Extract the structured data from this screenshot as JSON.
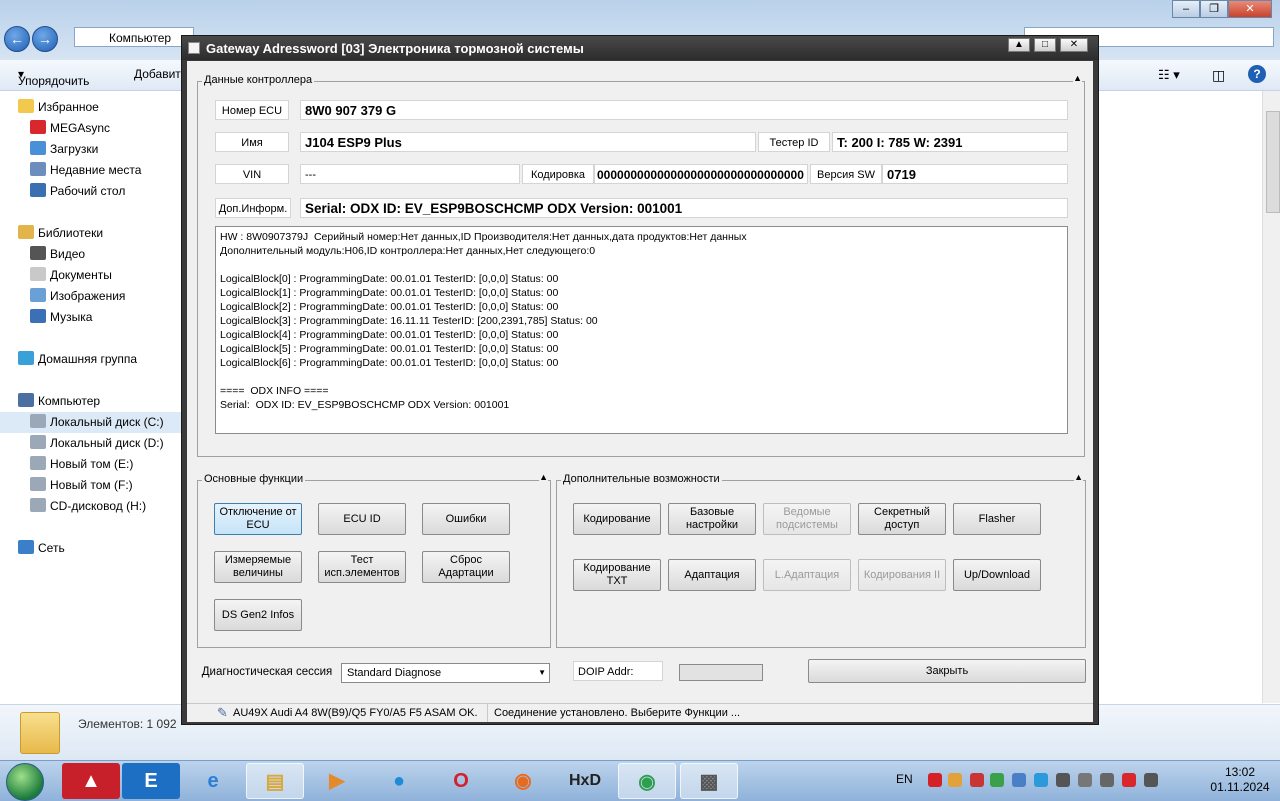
{
  "explorer": {
    "address": "Компьютер",
    "toolbar": {
      "organize": "Упорядочить",
      "add": "Добавит"
    },
    "sidebar": [
      {
        "label": "Избранное",
        "color": "#f2c94c"
      },
      {
        "label": "MEGAsync",
        "color": "#d9272e"
      },
      {
        "label": "Загрузки",
        "color": "#4a90d9"
      },
      {
        "label": "Недавние места",
        "color": "#6c8ebf"
      },
      {
        "label": "Рабочий стол",
        "color": "#3a6fb0"
      },
      {
        "label": "Библиотеки",
        "color": "#e2b44b"
      },
      {
        "label": "Видео",
        "color": "#555555"
      },
      {
        "label": "Документы",
        "color": "#c9c9c9"
      },
      {
        "label": "Изображения",
        "color": "#6aa0d8"
      },
      {
        "label": "Музыка",
        "color": "#3b6fb6"
      },
      {
        "label": "Домашняя группа",
        "color": "#3aa0d8"
      },
      {
        "label": "Компьютер",
        "color": "#4a6fa0"
      },
      {
        "label": "Локальный диск (C:)",
        "color": "#9aa8b8"
      },
      {
        "label": "Локальный диск (D:)",
        "color": "#9aa8b8"
      },
      {
        "label": "Новый том (E:)",
        "color": "#9aa8b8"
      },
      {
        "label": "Новый том (F:)",
        "color": "#9aa8b8"
      },
      {
        "label": "CD-дисковод (H:)",
        "color": "#9aa8b8"
      },
      {
        "label": "Сеть",
        "color": "#3a7fc8"
      }
    ],
    "status_count": "Элементов: 1 092"
  },
  "dialog": {
    "title": "Gateway Adressword [03] Электроника тормозной системы",
    "controller_group": "Данные контроллера",
    "fields": {
      "ecu_label": "Номер ECU",
      "ecu_value": "8W0 907 379 G",
      "name_label": "Имя",
      "name_value": "J104  ESP9 Plus",
      "tester_label": "Тестер ID",
      "tester_value": "T: 200 I: 785 W: 2391",
      "vin_label": "VIN",
      "vin_value": "---",
      "coding_label": "Кодировка",
      "coding_value": "0000000000000000000000000000000",
      "sw_label": "Версия SW",
      "sw_value": "0719",
      "extra_label": "Доп.Информ.",
      "extra_value": "Serial:  ODX ID: EV_ESP9BOSCHCMP ODX Version: 001001"
    },
    "info_lines": [
      "HW : 8W0907379J  Серийный номер:Нет данных,ID Производителя:Нет данных,дата продуктов:Нет данных",
      "Дополнительный модуль:H06,ID контроллера:Нет данных,Нет следующего:0",
      "",
      "LogicalBlock[0] : ProgrammingDate: 00.01.01 TesterID: [0,0,0] Status: 00",
      "LogicalBlock[1] : ProgrammingDate: 00.01.01 TesterID: [0,0,0] Status: 00",
      "LogicalBlock[2] : ProgrammingDate: 00.01.01 TesterID: [0,0,0] Status: 00",
      "LogicalBlock[3] : ProgrammingDate: 16.11.11 TesterID: [200,2391,785] Status: 00",
      "LogicalBlock[4] : ProgrammingDate: 00.01.01 TesterID: [0,0,0] Status: 00",
      "LogicalBlock[5] : ProgrammingDate: 00.01.01 TesterID: [0,0,0] Status: 00",
      "LogicalBlock[6] : ProgrammingDate: 00.01.01 TesterID: [0,0,0] Status: 00",
      "",
      "====  ODX INFO ====",
      "Serial:  ODX ID: EV_ESP9BOSCHCMP ODX Version: 001001"
    ],
    "basic_group": "Основные функции",
    "basic_buttons": {
      "disconnect": "Отключение от ECU",
      "ecu_id": "ECU ID",
      "errors": "Ошибки",
      "measured": "Измеряемые величины",
      "test": "Тест исп.элементов",
      "reset": "Сброс Адартации",
      "ds_gen2": "DS Gen2 Infos"
    },
    "extra_group": "Дополнительные возможности",
    "extra_buttons": {
      "coding": "Кодирование",
      "basic_settings": "Базовые настройки",
      "slave": "Ведомые подсистемы",
      "secret": "Секретный доступ",
      "flasher": "Flasher",
      "coding_txt": "Кодирование TXT",
      "adaptation": "Адаптация",
      "l_adaptation": "L.Адаптация",
      "coding2": "Кодирования II",
      "updown": "Up/Download"
    },
    "session_label": "Диагностическая сессия",
    "session_value": "Standard Diagnose",
    "doip_label": "DOIP Addr:",
    "close_label": "Закрыть",
    "status_vehicle": "AU49X Audi A4 8W(B9)/Q5 FY0/A5 F5 ASAM OK.",
    "status_message": "Соединение установлено. Выберите Функции ..."
  },
  "taskbar": {
    "lang": "EN",
    "time": "13:02",
    "date": "01.11.2024"
  },
  "colors": {
    "titlebar": "#2c2c2c",
    "client": "#f0f0f0",
    "focus": "#c6e4f8"
  }
}
